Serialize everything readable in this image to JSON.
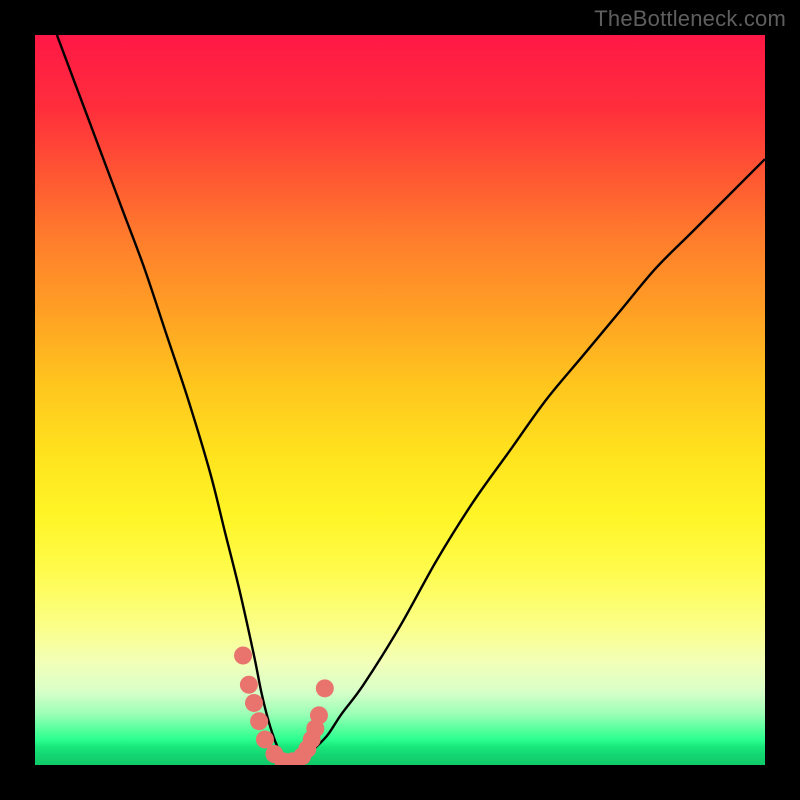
{
  "watermark": "TheBottleneck.com",
  "colors": {
    "background": "#000000",
    "curve": "#000000",
    "dots": "#e9746e",
    "watermark": "#5f5f5f"
  },
  "chart_data": {
    "type": "line",
    "title": "",
    "xlabel": "",
    "ylabel": "",
    "xlim": [
      0,
      100
    ],
    "ylim": [
      0,
      100
    ],
    "grid": false,
    "series": [
      {
        "name": "bottleneck-curve",
        "x": [
          3,
          6,
          9,
          12,
          15,
          18,
          21,
          24,
          26,
          28,
          30,
          31,
          32,
          33,
          34,
          35,
          36,
          37,
          38,
          40,
          42,
          45,
          50,
          55,
          60,
          65,
          70,
          75,
          80,
          85,
          90,
          95,
          100
        ],
        "y": [
          100,
          92,
          84,
          76,
          68,
          59,
          50,
          40,
          32,
          24,
          15,
          10,
          6,
          3,
          1,
          0,
          0,
          1,
          2,
          4,
          7,
          11,
          19,
          28,
          36,
          43,
          50,
          56,
          62,
          68,
          73,
          78,
          83
        ]
      }
    ],
    "scatter": {
      "name": "highlight-dots",
      "x": [
        28.5,
        29.3,
        30.0,
        30.7,
        31.5,
        32.8,
        34.0,
        35.3,
        36.6,
        37.3,
        37.9,
        38.4,
        38.9,
        39.7
      ],
      "y": [
        15.0,
        11.0,
        8.5,
        6.0,
        3.5,
        1.5,
        0.5,
        0.5,
        1.2,
        2.2,
        3.5,
        5.0,
        6.8,
        10.5
      ],
      "radius_px": 9
    },
    "gradient_stops": [
      {
        "pos": 0.0,
        "color": "#ff1846"
      },
      {
        "pos": 0.1,
        "color": "#ff2e3c"
      },
      {
        "pos": 0.2,
        "color": "#ff5a32"
      },
      {
        "pos": 0.28,
        "color": "#ff7d2c"
      },
      {
        "pos": 0.38,
        "color": "#ffa024"
      },
      {
        "pos": 0.48,
        "color": "#ffc61e"
      },
      {
        "pos": 0.58,
        "color": "#ffe41e"
      },
      {
        "pos": 0.66,
        "color": "#fff527"
      },
      {
        "pos": 0.73,
        "color": "#fffb4a"
      },
      {
        "pos": 0.81,
        "color": "#fbff88"
      },
      {
        "pos": 0.86,
        "color": "#f2ffb8"
      },
      {
        "pos": 0.9,
        "color": "#d7ffc9"
      },
      {
        "pos": 0.93,
        "color": "#9cffb6"
      },
      {
        "pos": 0.95,
        "color": "#5aff9e"
      },
      {
        "pos": 0.965,
        "color": "#2cff8f"
      },
      {
        "pos": 0.975,
        "color": "#18e87b"
      },
      {
        "pos": 0.985,
        "color": "#14d873"
      },
      {
        "pos": 1.0,
        "color": "#10c968"
      }
    ]
  }
}
